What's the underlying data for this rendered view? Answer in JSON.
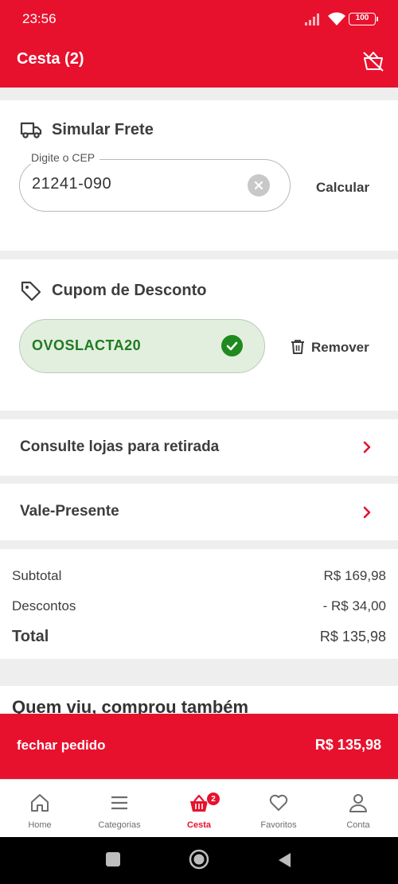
{
  "status_bar": {
    "time": "23:56",
    "battery": "100"
  },
  "app_bar": {
    "title": "Cesta (2)"
  },
  "shipping": {
    "title": "Simular Frete",
    "cep_label": "Digite o CEP",
    "cep_value": "21241-090",
    "calculate_label": "Calcular"
  },
  "coupon": {
    "title": "Cupom de Desconto",
    "code": "OVOSLACTA20",
    "remove_label": "Remover"
  },
  "links": {
    "stores": "Consulte lojas para retirada",
    "gift_card": "Vale-Presente"
  },
  "summary": {
    "subtotal_label": "Subtotal",
    "subtotal_value": "R$ 169,98",
    "discounts_label": "Descontos",
    "discounts_value": "- R$ 34,00",
    "total_label": "Total",
    "total_value": "R$ 135,98"
  },
  "recommendations": {
    "title": "Quem viu, comprou também"
  },
  "checkout": {
    "label": "fechar pedido",
    "value": "R$ 135,98"
  },
  "bottom_nav": {
    "items": [
      {
        "label": "Home",
        "icon": "home-icon"
      },
      {
        "label": "Categorias",
        "icon": "menu-icon"
      },
      {
        "label": "Cesta",
        "icon": "basket-icon",
        "badge": "2",
        "active": true
      },
      {
        "label": "Favoritos",
        "icon": "heart-icon"
      },
      {
        "label": "Conta",
        "icon": "user-icon"
      }
    ]
  },
  "colors": {
    "brand": "#e8112d",
    "success": "#1f8a1f",
    "success_bg": "#e2efdf"
  }
}
